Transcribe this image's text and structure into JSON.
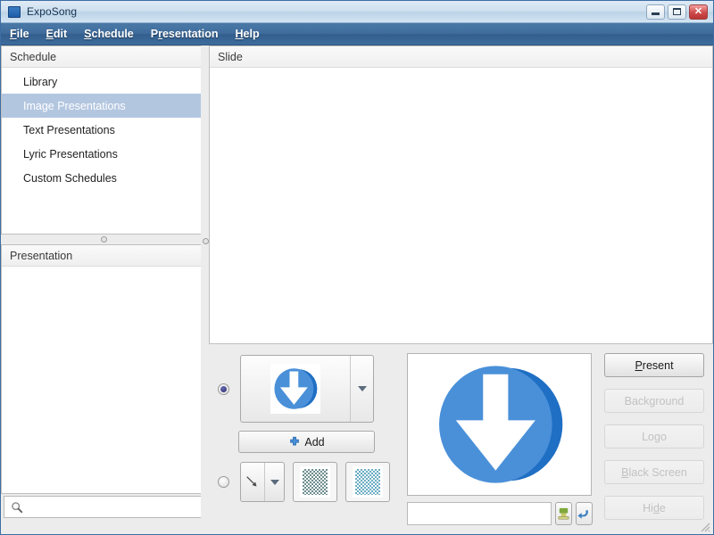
{
  "window": {
    "title": "ExpoSong",
    "icon": "app-icon",
    "controls": {
      "minimize": "minimize",
      "maximize": "maximize",
      "close": "close"
    }
  },
  "menubar": {
    "items": [
      {
        "mnemonic": "F",
        "rest": "ile"
      },
      {
        "mnemonic": "E",
        "rest": "dit"
      },
      {
        "mnemonic": "S",
        "rest": "chedule"
      },
      {
        "pre": "P",
        "mnemonic": "r",
        "rest": "esentation"
      },
      {
        "mnemonic": "H",
        "rest": "elp"
      }
    ]
  },
  "sidebar": {
    "schedule": {
      "header": "Schedule",
      "items": [
        {
          "label": "Library",
          "selected": false
        },
        {
          "label": "Image Presentations",
          "selected": true
        },
        {
          "label": "Text Presentations",
          "selected": false
        },
        {
          "label": "Lyric Presentations",
          "selected": false
        },
        {
          "label": "Custom Schedules",
          "selected": false
        }
      ]
    },
    "presentation": {
      "header": "Presentation",
      "items": []
    },
    "search": {
      "value": "",
      "placeholder": "",
      "icon": "search-icon"
    }
  },
  "main": {
    "slide_list": {
      "header": "Slide",
      "rows": []
    }
  },
  "toolbar": {
    "image_source": {
      "radio_selected": true,
      "combo_value": "download-arrow-icon",
      "dropdown_icon": "chevron-down-icon"
    },
    "add_button": {
      "label": "Add",
      "icon": "plus-icon"
    },
    "effect_source": {
      "radio_selected": false,
      "combo_value": "line-arrow-icon",
      "dropdown_icon": "chevron-down-icon"
    },
    "swatches": [
      {
        "name": "slate-teal",
        "color": "#6e8e90"
      },
      {
        "name": "sky-blue",
        "color": "#6aadc4"
      }
    ],
    "preview": {
      "image": "download-arrow-icon"
    },
    "name_field": {
      "value": "",
      "placeholder": ""
    },
    "apply_button": {
      "icon": "apply-icon"
    },
    "revert_button": {
      "icon": "undo-icon"
    }
  },
  "actions": [
    {
      "pre": "",
      "mnemonic": "P",
      "rest": "resent",
      "disabled": false
    },
    {
      "pre": "Back",
      "mnemonic": "g",
      "rest": "round",
      "disabled": true
    },
    {
      "pre": "Lo",
      "mnemonic": "g",
      "rest": "o",
      "disabled": true
    },
    {
      "pre": "",
      "mnemonic": "B",
      "rest": "lack Screen",
      "disabled": true
    },
    {
      "pre": "Hi",
      "mnemonic": "d",
      "rest": "e",
      "disabled": true
    }
  ],
  "colors": {
    "menubar": "#3f6c9c",
    "titlebar": "#cfe0f0",
    "selection": "#b3c6e0",
    "accent_blue": "#4a90d9",
    "window_bg": "#ececec"
  }
}
